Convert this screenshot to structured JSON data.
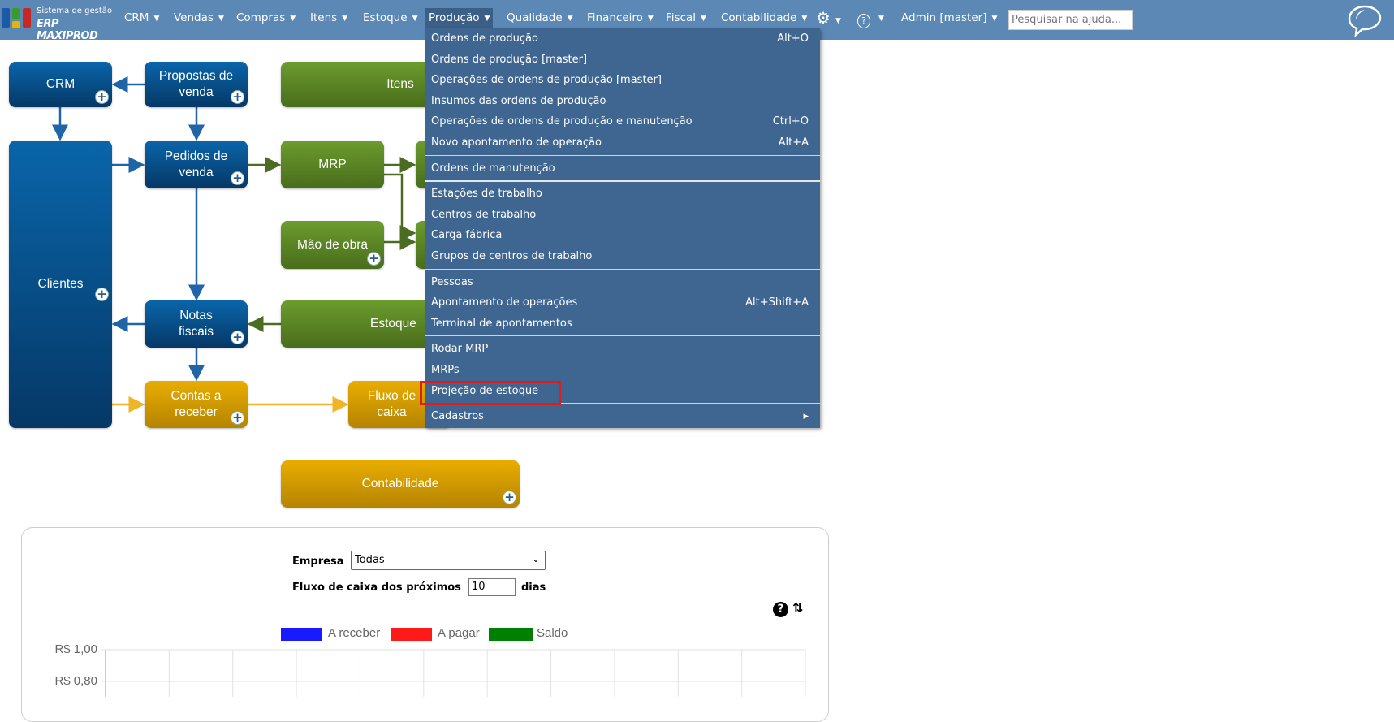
{
  "header": {
    "logo": {
      "line1": "Sistema de gestão",
      "line2": "ERP MAXIPROD"
    },
    "nav": [
      "CRM",
      "Vendas",
      "Compras",
      "Itens",
      "Estoque",
      "Produção",
      "Qualidade",
      "Financeiro",
      "Fiscal",
      "Contabilidade"
    ],
    "active": "Produção",
    "user": "Admin [master]",
    "search_placeholder": "Pesquisar na ajuda...",
    "icons": [
      "gear-icon",
      "help-icon",
      "chat-icon"
    ]
  },
  "menu": {
    "groups": [
      [
        {
          "label": "Ordens de produção",
          "shortcut": "Alt+O"
        },
        {
          "label": "Ordens de produção [master]",
          "shortcut": ""
        },
        {
          "label": "Operações de ordens de produção [master]",
          "shortcut": ""
        },
        {
          "label": "Insumos das ordens de produção",
          "shortcut": ""
        },
        {
          "label": "Operações de ordens de produção e manutenção",
          "shortcut": "Ctrl+O"
        },
        {
          "label": "Novo apontamento de operação",
          "shortcut": "Alt+A"
        }
      ],
      [
        {
          "label": "Ordens de manutenção",
          "shortcut": ""
        }
      ],
      [
        {
          "label": "Estações de trabalho",
          "shortcut": ""
        },
        {
          "label": "Centros de trabalho",
          "shortcut": ""
        },
        {
          "label": "Carga fábrica",
          "shortcut": ""
        },
        {
          "label": "Grupos de centros de trabalho",
          "shortcut": ""
        }
      ],
      [
        {
          "label": "Pessoas",
          "shortcut": ""
        },
        {
          "label": "Apontamento de operações",
          "shortcut": "Alt+Shift+A"
        },
        {
          "label": "Terminal de apontamentos",
          "shortcut": ""
        }
      ],
      [
        {
          "label": "Rodar MRP",
          "shortcut": ""
        },
        {
          "label": "MRPs",
          "shortcut": ""
        },
        {
          "label": "Projeção de estoque",
          "shortcut": ""
        }
      ],
      [
        {
          "label": "Cadastros",
          "shortcut": "▸"
        }
      ]
    ],
    "highlighted": "Projeção de estoque"
  },
  "diagram": {
    "crm": "CRM",
    "propostas": "Propostas de venda",
    "itens": "Itens",
    "clientes": "Clientes",
    "pedidos": "Pedidos de venda",
    "mrp": "MRP",
    "mao": "Mão de obra",
    "notas": "Notas fiscais",
    "estoque": "Estoque",
    "contas": "Contas a receber",
    "fluxo": "Fluxo de caixa",
    "contab": "Contabilidade",
    "plus": "+"
  },
  "panel": {
    "empresa_label": "Empresa",
    "empresa_value": "Todas",
    "fluxo_label": "Fluxo de caixa dos próximos",
    "dias_value": "10",
    "dias_label": "dias"
  },
  "chart_data": {
    "type": "line",
    "legend": [
      {
        "name": "A receber",
        "color": "#1a1aff"
      },
      {
        "name": "A pagar",
        "color": "#ff1a1a"
      },
      {
        "name": "Saldo",
        "color": "#008000"
      }
    ],
    "legend_position": "top-center",
    "yticks": [
      "R$ 1,00",
      "R$ 0,80"
    ],
    "ylim_visible": [
      0.8,
      1.0
    ],
    "grid": true,
    "series": []
  }
}
